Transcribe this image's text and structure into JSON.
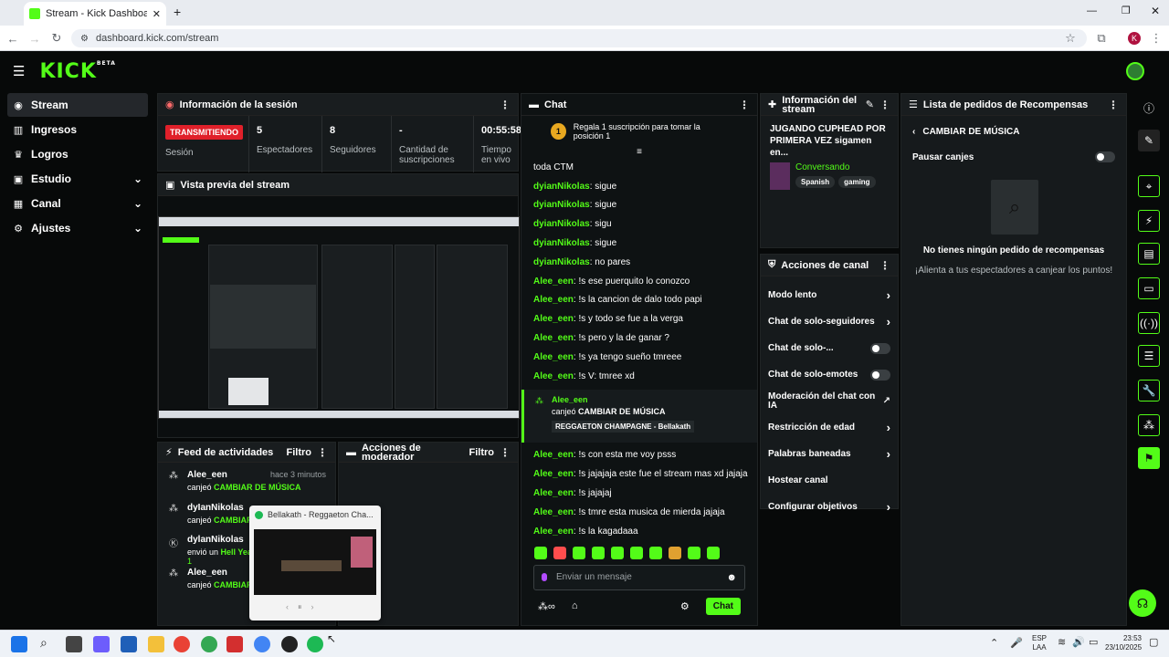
{
  "browser": {
    "tab_title": "Stream - Kick Dashboard",
    "url": "dashboard.kick.com/stream"
  },
  "brand": {
    "logo": "KICK",
    "beta": "BETA",
    "accent": "#53fc18"
  },
  "sidebar": {
    "items": [
      {
        "label": "Stream",
        "icon": "signal-icon",
        "active": true
      },
      {
        "label": "Ingresos",
        "icon": "chart-icon"
      },
      {
        "label": "Logros",
        "icon": "trophy-icon"
      },
      {
        "label": "Estudio",
        "icon": "studio-icon",
        "expandable": true
      },
      {
        "label": "Canal",
        "icon": "channel-icon",
        "expandable": true
      },
      {
        "label": "Ajustes",
        "icon": "gear-icon",
        "expandable": true
      }
    ]
  },
  "session": {
    "title": "Información de la sesión",
    "status": "TRANSMITIENDO",
    "session_label": "Sesión",
    "stats": [
      {
        "value": "5",
        "label": "Espectadores"
      },
      {
        "value": "8",
        "label": "Seguidores"
      },
      {
        "value": "-",
        "label": "Cantidad de suscripciones"
      },
      {
        "value": "00:55:58",
        "label": "Tiempo en vivo"
      }
    ]
  },
  "preview": {
    "title": "Vista previa del stream"
  },
  "activity": {
    "title": "Feed de actividades",
    "filter": "Filtro",
    "items": [
      {
        "user": "Alee_een",
        "time": "hace 3 minutos",
        "action": "canjeó",
        "detail": "CAMBIAR DE MÚSICA"
      },
      {
        "user": "dyIanNikolas",
        "action": "canjeó",
        "detail": "CAMBIAR"
      },
      {
        "user": "dylanNikolas",
        "action": "envió un",
        "detail": "Hell Yea",
        "count": "1"
      },
      {
        "user": "Alee_een",
        "action": "canjeó",
        "detail": "CAMBIAR"
      }
    ]
  },
  "mod_actions": {
    "title": "Acciones de moderador",
    "filter": "Filtro"
  },
  "spotify_popup": {
    "title": "Bellakath - Reggaeton Cha..."
  },
  "chat": {
    "title": "Chat",
    "banner": "Regala 1 suscripción para tomar la posición 1",
    "banner_rank": "1",
    "top_line": "toda CTM",
    "messages": [
      {
        "user": "dyianNikolas",
        "text": ": sigue"
      },
      {
        "user": "dyianNikolas",
        "text": ": sigue"
      },
      {
        "user": "dyianNikolas",
        "text": ": sigu"
      },
      {
        "user": "dyianNikolas",
        "text": ": sigue"
      },
      {
        "user": "dyianNikolas",
        "text": ": no pares"
      },
      {
        "user": "Alee_een",
        "text": ": !s ese puerquito lo conozco"
      },
      {
        "user": "Alee_een",
        "text": ": !s la cancion de dalo todo papi"
      },
      {
        "user": "Alee_een",
        "text": ": !s y todo se fue a la verga"
      },
      {
        "user": "Alee_een",
        "text": ": !s pero y la de ganar ?"
      },
      {
        "user": "Alee_een",
        "text": ": !s ya tengo sueño tmreee"
      },
      {
        "user": "Alee_een",
        "text": ": !s V: tmree xd"
      }
    ],
    "redeem": {
      "user": "Alee_een",
      "action": "canjeó",
      "reward": "CAMBIAR DE MÚSICA",
      "song": "REGGAETON CHAMPAGNE - Bellakath"
    },
    "messages2": [
      {
        "user": "Alee_een",
        "text": ": !s con esta me voy psss"
      },
      {
        "user": "Alee_een",
        "text": ": !s jajajaja este fue el stream mas xd jajaja"
      },
      {
        "user": "Alee_een",
        "text": ": !s jajajaj"
      },
      {
        "user": "Alee_een",
        "text": ": !s tmre esta musica de mierda jajaja"
      },
      {
        "user": "Alee_een",
        "text": ": !s la kagadaaa"
      }
    ],
    "placeholder": "Enviar un mensaje",
    "send": "Chat"
  },
  "stream_info": {
    "title": "Información del stream",
    "stream_title": "JUGANDO CUPHEAD POR PRIMERA VEZ sigamen en...",
    "category": "Conversando",
    "tags": [
      "Spanish",
      "gaming"
    ]
  },
  "channel_actions": {
    "title": "Acciones de canal",
    "items": [
      {
        "label": "Modo lento",
        "control": "chevron"
      },
      {
        "label": "Chat de solo-seguidores",
        "control": "chevron"
      },
      {
        "label": "Chat de solo-...",
        "control": "toggle"
      },
      {
        "label": "Chat de solo-emotes",
        "control": "toggle"
      },
      {
        "label": "Moderación del chat con IA",
        "control": "external"
      },
      {
        "label": "Restricción de edad",
        "control": "chevron"
      },
      {
        "label": "Palabras baneadas",
        "control": "chevron"
      },
      {
        "label": "Hostear canal",
        "control": "none"
      },
      {
        "label": "Configurar objetivos",
        "control": "chevron"
      }
    ]
  },
  "rewards": {
    "title": "Lista de pedidos de Recompensas",
    "back_label": "CAMBIAR DE MÚSICA",
    "pause_label": "Pausar canjes",
    "empty_title": "No tienes ningún pedido de recompensas",
    "empty_sub": "¡Alienta a tus espectadores a canjear los puntos!"
  },
  "taskbar": {
    "lang": "ESP",
    "lang2": "LAA",
    "time": "23:53",
    "date": "23/10/2025"
  }
}
